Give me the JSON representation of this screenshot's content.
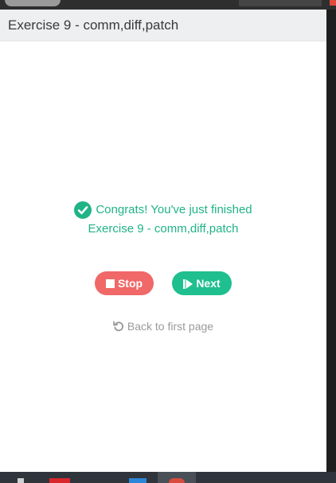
{
  "header": {
    "title": "Exercise 9 - comm,diff,patch"
  },
  "congrats": {
    "line1": "Congrats! You've just finished",
    "line2": "Exercise 9 - comm,diff,patch",
    "icon": "check-circle-icon"
  },
  "buttons": {
    "stop_label": "Stop",
    "next_label": "Next"
  },
  "back_link": {
    "label": "Back to first page",
    "icon": "undo-icon"
  },
  "colors": {
    "accent_green": "#20b386",
    "stop_red": "#f06868",
    "next_green": "#1fbf8f",
    "muted_gray": "#9a9a9a"
  }
}
